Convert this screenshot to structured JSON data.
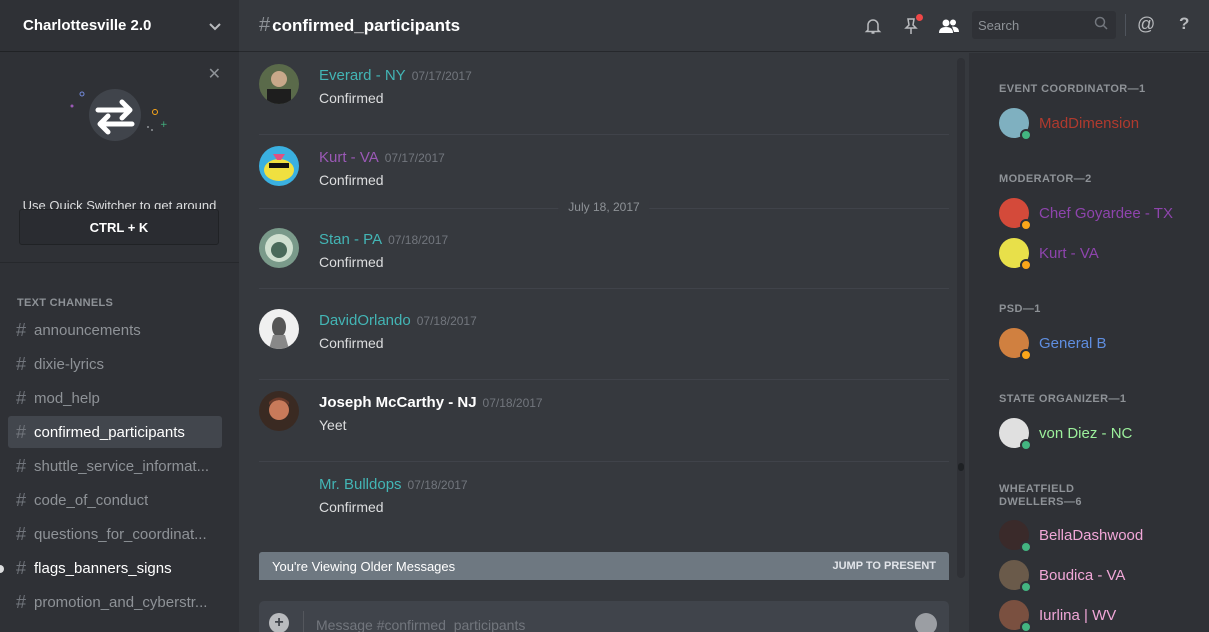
{
  "server": {
    "name": "Charlottesville 2.0"
  },
  "quick_switcher": {
    "text": "Use Quick Switcher to get around Discord quickly. Just press:",
    "shortcut": "CTRL + K"
  },
  "channels": {
    "category": "TEXT CHANNELS",
    "items": [
      {
        "name": "announcements",
        "state": "normal"
      },
      {
        "name": "dixie-lyrics",
        "state": "normal"
      },
      {
        "name": "mod_help",
        "state": "normal"
      },
      {
        "name": "confirmed_participants",
        "state": "active"
      },
      {
        "name": "shuttle_service_informat...",
        "state": "normal"
      },
      {
        "name": "code_of_conduct",
        "state": "normal"
      },
      {
        "name": "questions_for_coordinat...",
        "state": "normal"
      },
      {
        "name": "flags_banners_signs",
        "state": "unread"
      },
      {
        "name": "promotion_and_cyberstr...",
        "state": "normal"
      }
    ]
  },
  "header": {
    "hash": "#",
    "channel": "confirmed_participants",
    "search_placeholder": "Search"
  },
  "messages": [
    {
      "author": "Everard - NY",
      "color": "#43b5b5",
      "time": "07/17/2017",
      "text": "Confirmed",
      "avatar": "#5a6a4a"
    },
    {
      "author": "Kurt - VA",
      "color": "#9b59b6",
      "time": "07/17/2017",
      "text": "Confirmed",
      "avatar": "#e8e04a"
    },
    {
      "author": "Stan - PA",
      "color": "#43b5b5",
      "time": "07/18/2017",
      "text": "Confirmed",
      "avatar": "#6f8f7f"
    },
    {
      "author": "DavidOrlando",
      "color": "#43b5b5",
      "time": "07/18/2017",
      "text": "Confirmed",
      "avatar": "#d0d0d0"
    },
    {
      "author": "Joseph McCarthy - NJ",
      "color": "#ffffff",
      "time": "07/18/2017",
      "text": "Yeet",
      "avatar": "#8a4a3a"
    },
    {
      "author": "Mr. Bulldops",
      "color": "#43b5b5",
      "time": "07/18/2017",
      "text": "Confirmed",
      "avatar": ""
    }
  ],
  "date_divider": "July 18, 2017",
  "older_bar": {
    "text": "You're Viewing Older Messages",
    "action": "JUMP TO PRESENT"
  },
  "composer": {
    "placeholder": "Message #confirmed_participants"
  },
  "member_list": {
    "roles": [
      {
        "label": "EVENT COORDINATOR—1",
        "members": [
          {
            "name": "MadDimension",
            "color": "#b03a2e",
            "status": "#43b581",
            "avatar": "#7fb0c0"
          }
        ]
      },
      {
        "label": "MODERATOR—2",
        "members": [
          {
            "name": "Chef Goyardee - TX",
            "color": "#8e44ad",
            "status": "#faa61a",
            "avatar": "#d44a3a"
          },
          {
            "name": "Kurt - VA",
            "color": "#8e44ad",
            "status": "#faa61a",
            "avatar": "#e8e04a"
          }
        ]
      },
      {
        "label": "PSD—1",
        "members": [
          {
            "name": "General B",
            "color": "#5f8ee0",
            "status": "#faa61a",
            "avatar": "#d08040"
          }
        ]
      },
      {
        "label": "STATE ORGANIZER—1",
        "members": [
          {
            "name": "von Diez - NC",
            "color": "#9cf09c",
            "status": "#43b581",
            "avatar": "#e0e0e0"
          }
        ]
      },
      {
        "label": "WHEATFIELD DWELLERS—6",
        "members": [
          {
            "name": "BellaDashwood",
            "color": "#f1a7d8",
            "status": "#43b581",
            "avatar": "#3a2a2a"
          },
          {
            "name": "Boudica - VA",
            "color": "#f1a7d8",
            "status": "#43b581",
            "avatar": "#6a5a4a"
          },
          {
            "name": "Iurlina | WV",
            "color": "#f1a7d8",
            "status": "#43b581",
            "avatar": "#7a5040"
          }
        ]
      }
    ]
  }
}
